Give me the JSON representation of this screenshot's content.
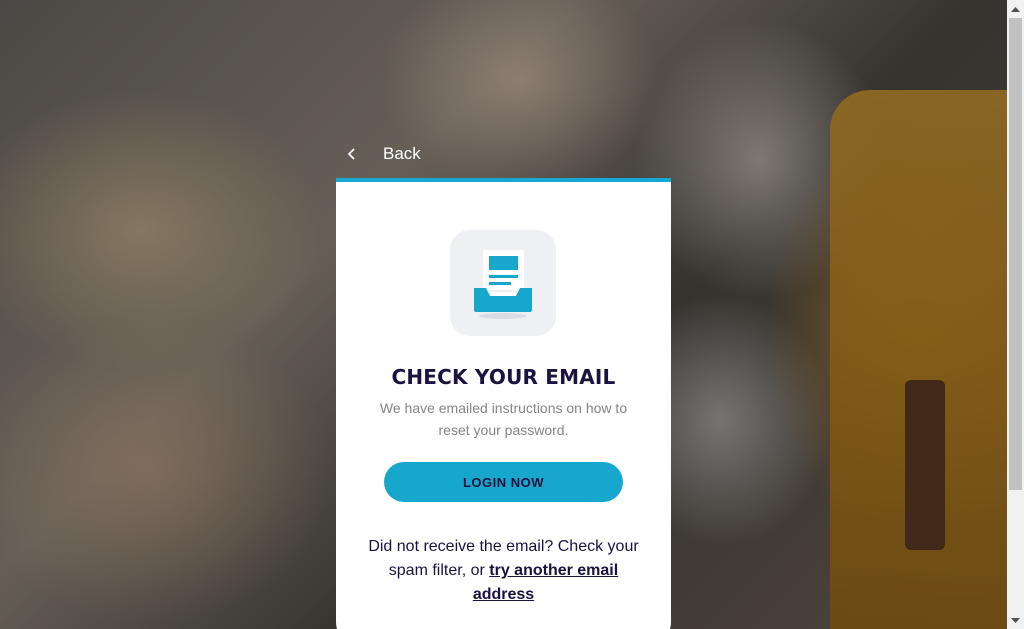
{
  "nav": {
    "back_label": "Back"
  },
  "card": {
    "icon": "inbox-mail-icon",
    "title": "CHECK YOUR EMAIL",
    "description": "We have emailed instructions on how to reset your password.",
    "login_button_label": "LOGIN NOW",
    "help_text": "Did not receive the email? Check your spam filter, or ",
    "help_link_label": "try another email address"
  },
  "colors": {
    "accent": "#14a8d2",
    "title": "#1c1240",
    "muted_text": "#858585"
  }
}
